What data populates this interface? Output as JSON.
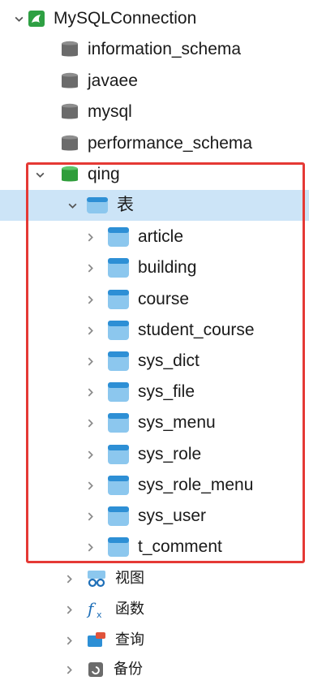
{
  "tree": {
    "connection": {
      "label": "MySQLConnection",
      "expanded": true,
      "icon": "mysql-dolphin-icon",
      "color": "#2ea043"
    },
    "databases_before": [
      {
        "label": "information_schema",
        "icon": "database-gray-icon"
      },
      {
        "label": "javaee",
        "icon": "database-gray-icon"
      },
      {
        "label": "mysql",
        "icon": "database-gray-icon"
      },
      {
        "label": "performance_schema",
        "icon": "database-gray-icon"
      }
    ],
    "active_database": {
      "label": "qing",
      "expanded": true,
      "icon": "database-green-icon"
    },
    "tables_group": {
      "label": "表",
      "expanded": true,
      "selected": true,
      "icon": "table-folder-icon"
    },
    "tables": [
      {
        "label": "article"
      },
      {
        "label": "building"
      },
      {
        "label": "course"
      },
      {
        "label": "student_course"
      },
      {
        "label": "sys_dict"
      },
      {
        "label": "sys_file"
      },
      {
        "label": "sys_menu"
      },
      {
        "label": "sys_role"
      },
      {
        "label": "sys_role_menu"
      },
      {
        "label": "sys_user"
      },
      {
        "label": "t_comment"
      }
    ],
    "other_groups": [
      {
        "label": "视图",
        "icon": "view-icon"
      },
      {
        "label": "函数",
        "icon": "function-icon"
      },
      {
        "label": "查询",
        "icon": "query-icon"
      },
      {
        "label": "备份",
        "icon": "backup-icon"
      }
    ]
  },
  "colors": {
    "selection": "#cce4f7",
    "highlight_border": "#e53935",
    "table_icon": "#2d8fd5",
    "db_gray": "#6b6b6b",
    "db_green": "#2e9d3a"
  }
}
